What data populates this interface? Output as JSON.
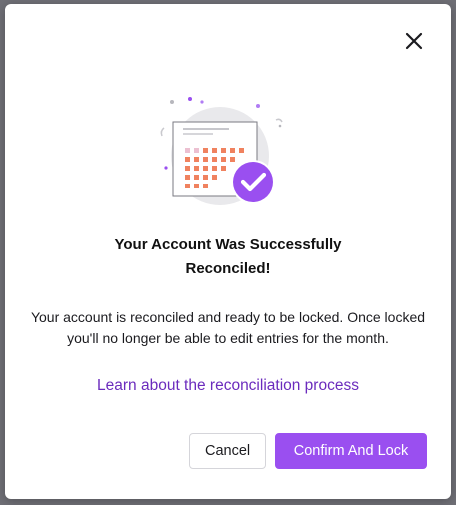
{
  "modal": {
    "title_line1": "Your Account Was Successfully",
    "title_line2": "Reconciled!",
    "message": "Your account is reconciled and ready to be locked. Once locked you'll no longer be able to edit entries for the month.",
    "learn_link": "Learn about the reconciliation process",
    "cancel_label": "Cancel",
    "confirm_label": "Confirm And Lock",
    "close_icon": "close-icon",
    "illustration_icon": "calendar-check-icon"
  },
  "colors": {
    "accent": "#9a4ff0",
    "link": "#6b2bbd",
    "calendar_cells": "#f0825f"
  }
}
